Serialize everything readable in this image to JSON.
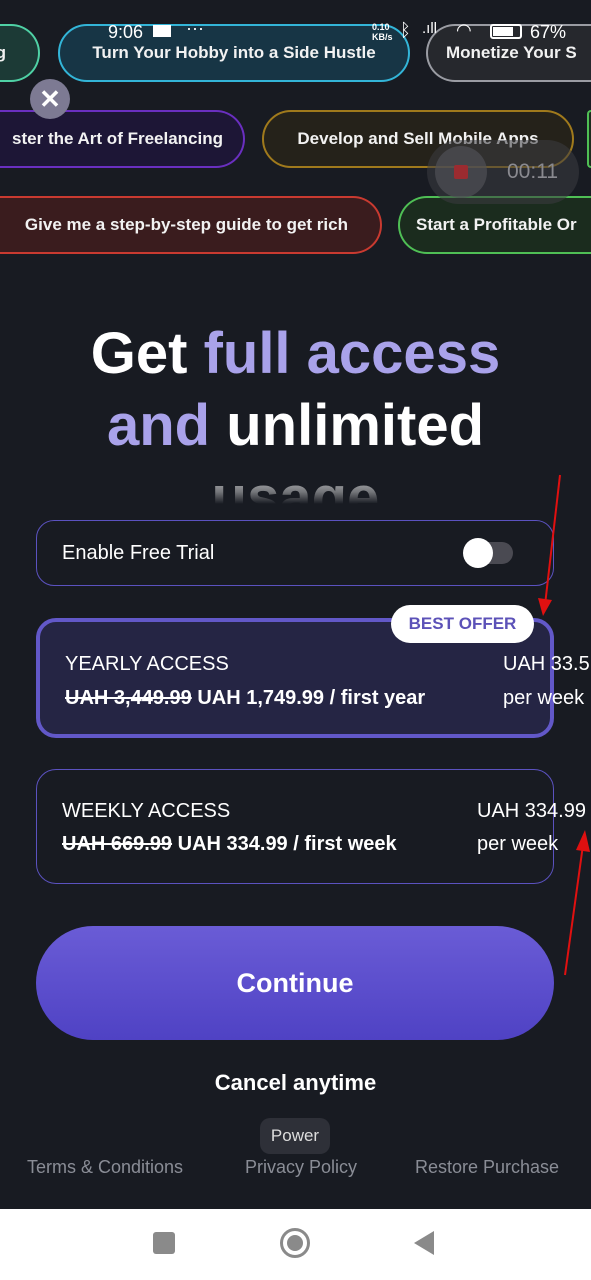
{
  "status_bar": {
    "time": "9:06",
    "net_speed": "0.10 KB/s",
    "battery": "67%"
  },
  "chips": [
    {
      "label": "g",
      "color": "#4fd1a5"
    },
    {
      "label": "Turn Your Hobby into a Side Hustle",
      "color": "#33b5d8"
    },
    {
      "label": "Monetize Your S",
      "color": "#9a9ca3"
    },
    {
      "label": "ster the Art of Freelancing",
      "color": "#6a2fc0"
    },
    {
      "label": "Develop and Sell Mobile Apps",
      "color": "#a07a1c"
    },
    {
      "label": "Give me a step-by-step guide to get rich",
      "color": "#c93a30"
    },
    {
      "label": "Start a Profitable Or",
      "color": "#4fbf55"
    }
  ],
  "recorder": {
    "time": "00:11"
  },
  "headline": {
    "w1": "Get",
    "w2": "full access",
    "w3": "and",
    "w4": "unlimited",
    "w5": "usage"
  },
  "free_trial": {
    "label": "Enable Free Trial",
    "enabled": false
  },
  "plans": [
    {
      "title": "YEARLY ACCESS",
      "old_price": "UAH 3,449.99",
      "price": "UAH 1,749.99 / first year",
      "right_price": "UAH 33.5",
      "right_unit": "per week",
      "badge": "BEST OFFER",
      "selected": true
    },
    {
      "title": "WEEKLY ACCESS",
      "old_price": "UAH 669.99",
      "price": "UAH 334.99 / first week",
      "right_price": "UAH 334.99",
      "right_unit": "per week",
      "selected": false
    }
  ],
  "continue_label": "Continue",
  "cancel_label": "Cancel anytime",
  "tooltip": "Power",
  "footer": {
    "terms": "Terms & Conditions",
    "privacy": "Privacy Policy",
    "restore": "Restore Purchase"
  }
}
